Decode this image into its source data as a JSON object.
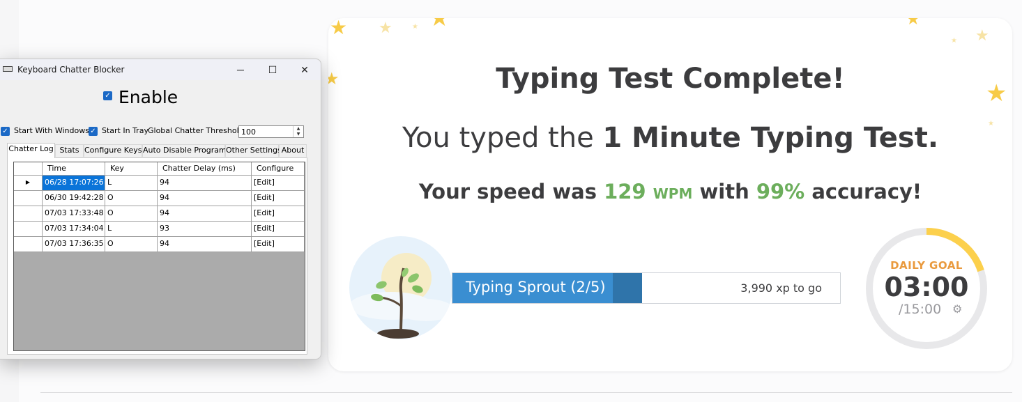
{
  "card": {
    "title": "Typing Test Complete!",
    "subtitle_prefix": "You typed the",
    "subtitle_test": "1 Minute Typing Test.",
    "speed_prefix": "Your speed was",
    "speed_value": "129",
    "speed_unit": "WPM",
    "speed_mid": "with",
    "accuracy": "99%",
    "speed_suffix": "accuracy!",
    "xp_bar": {
      "label": "Typing Sprout (2/5)",
      "togo": "3,990 xp to go",
      "progress": 0.49
    },
    "daily_goal": {
      "label": "DAILY GOAL",
      "time": "03:00",
      "total": "/15:00",
      "progress": 0.2
    },
    "colors": {
      "accent_green": "#6cae5c",
      "bar_blue": "#3a8ed1",
      "goal_orange": "#e99a3e",
      "goal_ring": "#fcd04c"
    }
  },
  "window": {
    "title": "Keyboard Chatter Blocker",
    "controls": {
      "minimize": "─",
      "maximize": "☐",
      "close": "✕"
    },
    "enable_label": "Enable",
    "enable_checked": true,
    "options": {
      "start_with_windows": "Start With Windows",
      "start_in_tray": "Start In Tray",
      "threshold_label": "Global Chatter Threshold:",
      "threshold_value": "100"
    },
    "tabs": [
      "Chatter Log",
      "Stats",
      "Configure Keys",
      "Auto Disable Programs",
      "Other Settings",
      "About"
    ],
    "active_tab": "Chatter Log",
    "grid": {
      "columns": [
        "Time",
        "Key",
        "Chatter Delay (ms)",
        "Configure"
      ],
      "rows": [
        {
          "time": "06/28 17:07:26",
          "key": "L",
          "delay": "94",
          "configure": "[Edit]",
          "current": true
        },
        {
          "time": "06/30 19:42:28",
          "key": "O",
          "delay": "94",
          "configure": "[Edit]"
        },
        {
          "time": "07/03 17:33:48",
          "key": "O",
          "delay": "94",
          "configure": "[Edit]"
        },
        {
          "time": "07/03 17:34:04",
          "key": "L",
          "delay": "93",
          "configure": "[Edit]"
        },
        {
          "time": "07/03 17:36:35",
          "key": "O",
          "delay": "94",
          "configure": "[Edit]"
        }
      ]
    }
  }
}
